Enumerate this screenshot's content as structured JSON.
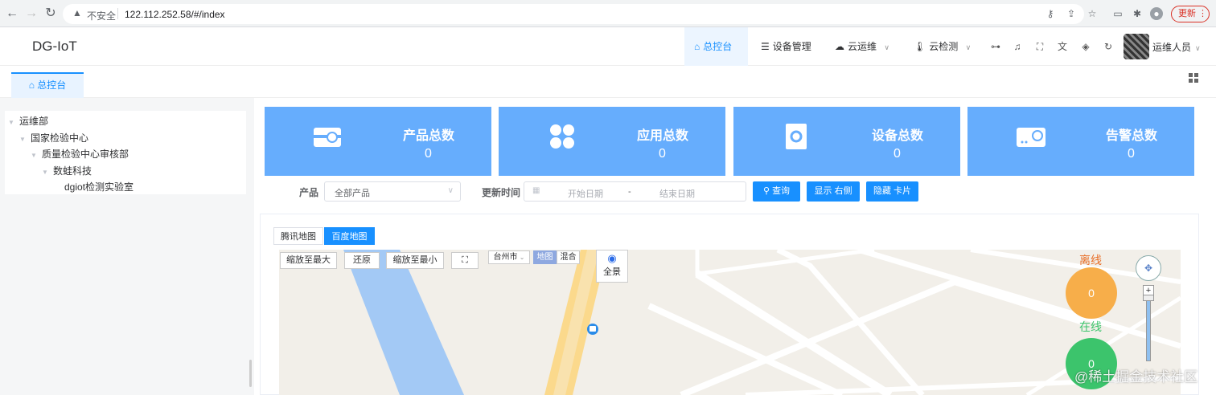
{
  "browser": {
    "insecure_label": "不安全",
    "url": "122.112.252.58/#/index",
    "update_label": "更新"
  },
  "header": {
    "title": "DG-IoT",
    "menu": [
      {
        "label": "总控台",
        "icon": "home-icon"
      },
      {
        "label": "设备管理",
        "icon": "list-icon"
      },
      {
        "label": "云运维",
        "icon": "cloud-icon"
      },
      {
        "label": "云检测",
        "icon": "thermometer-icon"
      }
    ],
    "user_name": "运维人员"
  },
  "tabs": {
    "active_label": "总控台"
  },
  "tree": {
    "nodes": [
      {
        "label": "运维部",
        "level": 0
      },
      {
        "label": "国家检验中心",
        "level": 1
      },
      {
        "label": "质量检验中心审核部",
        "level": 2
      },
      {
        "label": "数蛙科技",
        "level": 3
      },
      {
        "label": "dgiot检测实验室",
        "level": 4
      }
    ]
  },
  "cards": [
    {
      "title": "产品总数",
      "value": "0",
      "icon": "product-icon"
    },
    {
      "title": "应用总数",
      "value": "0",
      "icon": "app-icon"
    },
    {
      "title": "设备总数",
      "value": "0",
      "icon": "device-icon"
    },
    {
      "title": "告警总数",
      "value": "0",
      "icon": "alarm-icon"
    }
  ],
  "filters": {
    "product_label": "产品",
    "product_value": "全部产品",
    "time_label": "更新时间",
    "start_placeholder": "开始日期",
    "range_separator": "-",
    "end_placeholder": "结束日期",
    "query_button": "查询",
    "show_right_button": "显示 右侧",
    "hide_card_button": "隐藏 卡片"
  },
  "map": {
    "tabs": [
      "腾讯地图",
      "百度地图"
    ],
    "active_tab": "百度地图",
    "zoom_max": "缩放至最大",
    "restore": "还原",
    "zoom_min": "缩放至最小",
    "city": "台州市",
    "map_type_map": "地图",
    "map_type_hybrid": "混合",
    "panorama": "全景",
    "offline_label": "离线",
    "offline_count": "0",
    "online_label": "在线",
    "online_count": "0",
    "offline_color": "#f7ae4a",
    "online_color": "#3cc46c"
  },
  "watermark": "@稀土掘金技术社区"
}
